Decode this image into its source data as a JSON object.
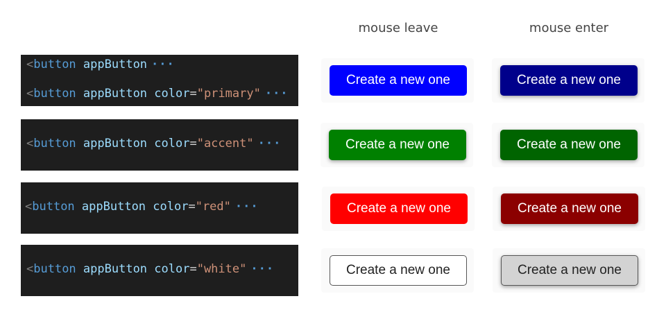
{
  "headers": {
    "mouse_leave": "mouse leave",
    "mouse_enter": "mouse enter"
  },
  "code": {
    "rows": [
      {
        "lines": [
          {
            "open": "<",
            "tag": "button",
            "attr": "appButton",
            "eq": "",
            "str": "",
            "ellipsis": "···"
          },
          {
            "open": "<",
            "tag": "button",
            "attr": "appButton color",
            "eq": "=",
            "str": "\"primary\"",
            "ellipsis": "···"
          }
        ]
      },
      {
        "lines": [
          {
            "open": "<",
            "tag": "button",
            "attr": "appButton color",
            "eq": "=",
            "str": "\"accent\"",
            "ellipsis": "···"
          }
        ]
      },
      {
        "lines": [
          {
            "open": "<",
            "tag": "button",
            "attr": "appButton color",
            "eq": "=",
            "str": "\"red\"",
            "ellipsis": "···"
          }
        ]
      },
      {
        "lines": [
          {
            "open": "<",
            "tag": "button",
            "attr": "appButton color",
            "eq": "=",
            "str": "\"white\"",
            "ellipsis": "···"
          }
        ]
      }
    ]
  },
  "buttons": {
    "label": "Create a new one",
    "rows": [
      {
        "variant": "primary",
        "leave": {
          "label": "Create a new one",
          "bg": "#0000ff",
          "fg": "#ffffff",
          "border": "#0000ff"
        },
        "enter": {
          "label": "Create a new one",
          "bg": "#00008b",
          "fg": "#ffffff",
          "border": "#00008b"
        }
      },
      {
        "variant": "accent",
        "leave": {
          "label": "Create a new one",
          "bg": "#008000",
          "fg": "#ffffff",
          "border": "#008000"
        },
        "enter": {
          "label": "Create a new one",
          "bg": "#006400",
          "fg": "#ffffff",
          "border": "#006400"
        }
      },
      {
        "variant": "red",
        "leave": {
          "label": "Create a new one",
          "bg": "#ff0000",
          "fg": "#ffffff",
          "border": "#ff0000"
        },
        "enter": {
          "label": "Create a new one",
          "bg": "#8b0000",
          "fg": "#ffffff",
          "border": "#8b0000"
        }
      },
      {
        "variant": "white",
        "leave": {
          "label": "Create a new one",
          "bg": "#ffffff",
          "fg": "#222222",
          "border": "#555555"
        },
        "enter": {
          "label": "Create a new one",
          "bg": "#d3d3d3",
          "fg": "#222222",
          "border": "#555555"
        }
      }
    ]
  }
}
